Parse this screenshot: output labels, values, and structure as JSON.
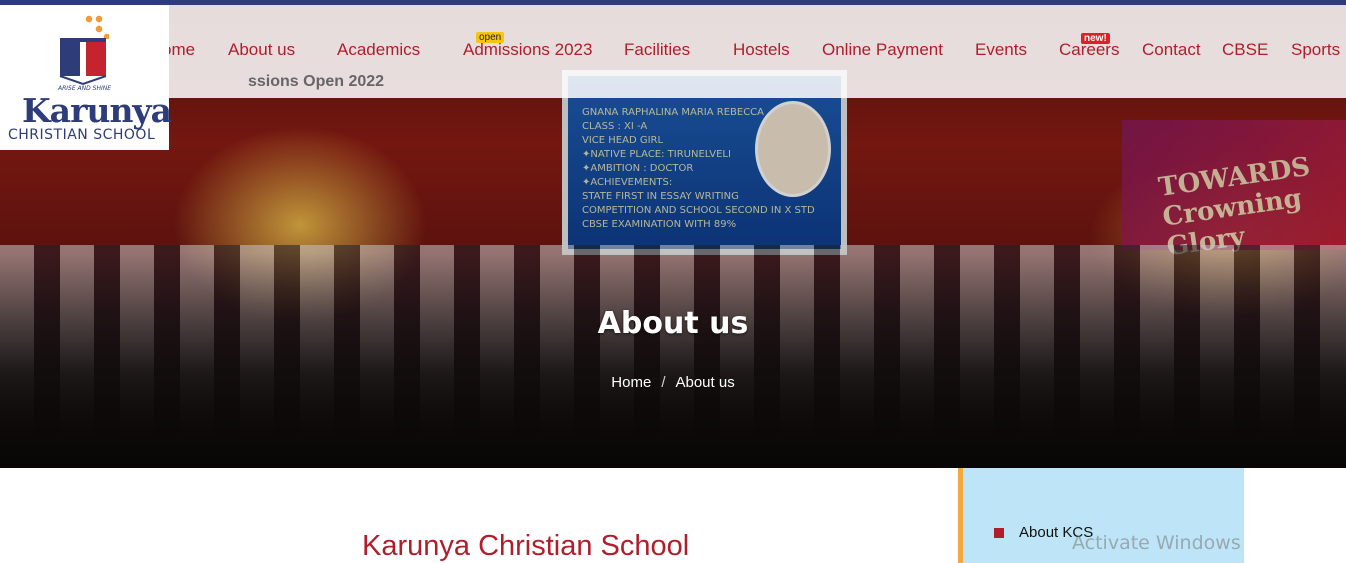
{
  "nav": {
    "items": [
      "ome",
      "About us",
      "Academics",
      "Admissions 2023",
      "Facilities",
      "Hostels",
      "Online Payment",
      "Events",
      "Careers",
      "Contact",
      "CBSE",
      "Sports"
    ],
    "open_badge": "open",
    "new_badge": "new!",
    "ticker": "ssions Open 2022"
  },
  "logo": {
    "tagline": "ARISE AND SHINE",
    "name": "Karunya",
    "sub": "CHRISTIAN SCHOOL"
  },
  "hero": {
    "title": "About us",
    "breadcrumb": [
      "Home",
      "About us"
    ],
    "breadcrumb_sep": "/",
    "screen_text": [
      "GNANA RAPHALINA MARIA REBECCA",
      "CLASS : XI -A",
      "VICE HEAD GIRL",
      "✦NATIVE PLACE: TIRUNELVELI",
      "✦AMBITION : DOCTOR",
      "✦ACHIEVEMENTS:",
      "STATE FIRST IN ESSAY WRITING",
      "COMPETITION AND SCHOOL SECOND IN X STD",
      "CBSE EXAMINATION WITH 89%"
    ],
    "banner": "TOWARDS Crowning Glory"
  },
  "content": {
    "title": "Karunya Christian School"
  },
  "sidebar": {
    "items": [
      "About KCS"
    ]
  },
  "watermark": "Activate Windows",
  "colors": {
    "brand_red": "#b11e2b",
    "brand_navy": "#2e3c7a",
    "sidebar_bg": "#bde5f7",
    "sidebar_accent": "#f2a93b"
  }
}
